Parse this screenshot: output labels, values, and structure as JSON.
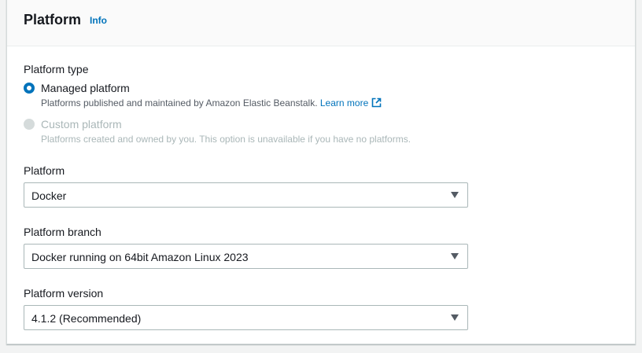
{
  "section": {
    "title": "Platform",
    "info_link": "Info"
  },
  "platform_type": {
    "label": "Platform type",
    "options": [
      {
        "label": "Managed platform",
        "description": "Platforms published and maintained by Amazon Elastic Beanstalk.",
        "link_text": "Learn more",
        "selected": true,
        "disabled": false
      },
      {
        "label": "Custom platform",
        "description": "Platforms created and owned by you. This option is unavailable if you have no platforms.",
        "selected": false,
        "disabled": true
      }
    ]
  },
  "platform": {
    "label": "Platform",
    "value": "Docker"
  },
  "platform_branch": {
    "label": "Platform branch",
    "value": "Docker running on 64bit Amazon Linux 2023"
  },
  "platform_version": {
    "label": "Platform version",
    "value": "4.1.2 (Recommended)"
  },
  "colors": {
    "accent": "#0073bb",
    "disabled": "#aab7b8",
    "border": "#aab7b8"
  }
}
